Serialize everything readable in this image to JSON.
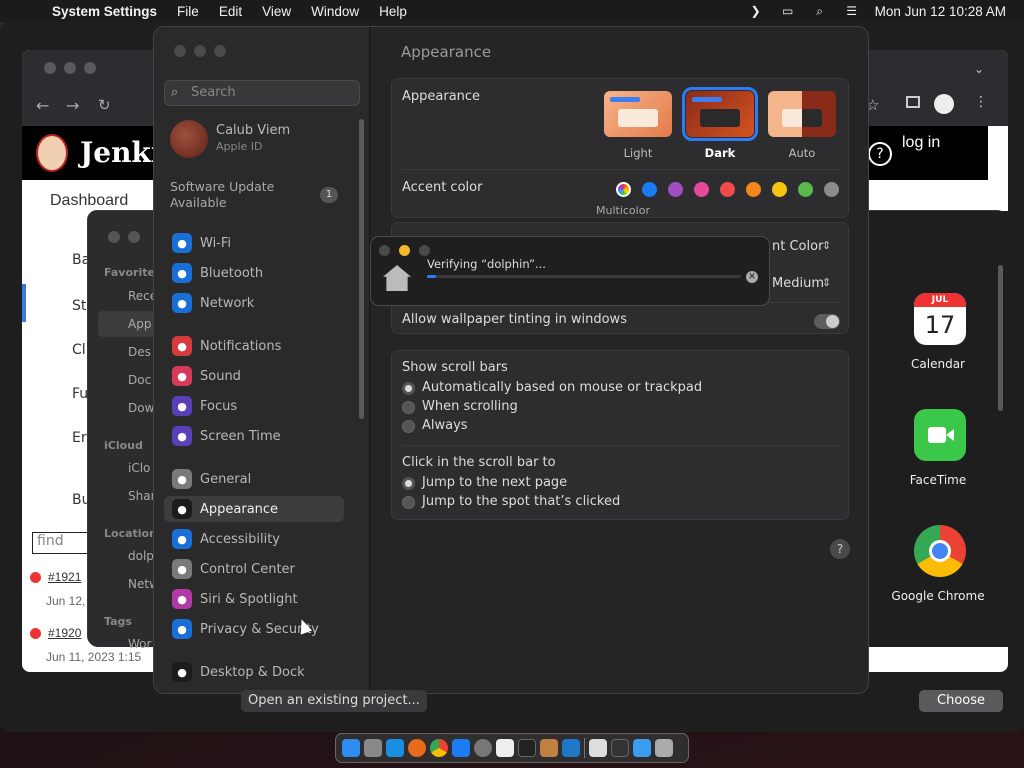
{
  "menubar": {
    "app": "System Settings",
    "items": [
      "File",
      "Edit",
      "View",
      "Window",
      "Help"
    ],
    "clock": "Mon Jun 12  10:28 AM"
  },
  "jenkins": {
    "title": "Jenki",
    "dashboard": "Dashboard",
    "login": "log in",
    "side_items": [
      "Ba",
      "St",
      "Cl",
      "Fu",
      "Er",
      "Bu"
    ],
    "find_placeholder": "find",
    "builds": [
      {
        "id": "#1921",
        "date": "Jun 12,"
      },
      {
        "id": "#1920",
        "date": "Jun 11, 2023 1:15"
      }
    ]
  },
  "finder": {
    "favorites_label": "Favorites",
    "favorites": [
      "Rece",
      "App",
      "Des",
      "Doc",
      "Dow"
    ],
    "icloud_label": "iCloud",
    "icloud": [
      "iClo",
      "Shar"
    ],
    "locations_label": "Location",
    "locations": [
      "dolp",
      "Netw"
    ],
    "tags_label": "Tags",
    "tags": [
      "Wor"
    ],
    "apps": [
      {
        "name": "Calendar",
        "month": "JUL",
        "day": "17"
      },
      {
        "name": "FaceTime"
      },
      {
        "name": "Google Chrome"
      }
    ]
  },
  "settings": {
    "search_placeholder": "Search",
    "user": {
      "name": "Calub Viem",
      "sub": "Apple ID"
    },
    "update": {
      "text": "Software Update Available",
      "count": "1"
    },
    "items": [
      {
        "label": "Wi-Fi",
        "color": "#1a6fd6",
        "icon": "wifi-icon"
      },
      {
        "label": "Bluetooth",
        "color": "#1a6fd6",
        "icon": "bluetooth-icon"
      },
      {
        "label": "Network",
        "color": "#1a6fd6",
        "icon": "globe-icon"
      },
      {
        "label": "Notifications",
        "color": "#d63a3a",
        "icon": "bell-icon"
      },
      {
        "label": "Sound",
        "color": "#d63a5a",
        "icon": "speaker-icon"
      },
      {
        "label": "Focus",
        "color": "#5b3fb8",
        "icon": "moon-icon"
      },
      {
        "label": "Screen Time",
        "color": "#5b3fb8",
        "icon": "hourglass-icon"
      },
      {
        "label": "General",
        "color": "#7a7a7c",
        "icon": "gear-icon"
      },
      {
        "label": "Appearance",
        "color": "#1c1c1e",
        "icon": "appearance-icon"
      },
      {
        "label": "Accessibility",
        "color": "#1a6fd6",
        "icon": "accessibility-icon"
      },
      {
        "label": "Control Center",
        "color": "#7a7a7c",
        "icon": "control-center-icon"
      },
      {
        "label": "Siri & Spotlight",
        "color": "#b03aa8",
        "icon": "siri-icon"
      },
      {
        "label": "Privacy & Security",
        "color": "#1a6fd6",
        "icon": "hand-icon"
      },
      {
        "label": "Desktop & Dock",
        "color": "#1c1c1e",
        "icon": "dock-icon"
      }
    ],
    "page_title": "Appearance",
    "appearance": {
      "label": "Appearance",
      "options": [
        "Light",
        "Dark",
        "Auto"
      ],
      "selected": "Dark"
    },
    "accent": {
      "label": "Accent color",
      "colors": [
        "#a86ad8",
        "#1a7cf0",
        "#a04fc0",
        "#e54a9a",
        "#ee4b4b",
        "#f2871b",
        "#f5c411",
        "#5bb84a",
        "#8c8c8c"
      ],
      "caption": "Multicolor"
    },
    "highlight_value": "nt Color",
    "sidebar_icon_size_value": "Medium",
    "wallpaper_tinting": "Allow wallpaper tinting in windows",
    "scroll": {
      "title": "Show scroll bars",
      "options": [
        "Automatically based on mouse or trackpad",
        "When scrolling",
        "Always"
      ],
      "click_title": "Click in the scroll bar to",
      "click_options": [
        "Jump to the next page",
        "Jump to the spot that’s clicked"
      ]
    }
  },
  "verify": {
    "text": "Verifying “dolphin”...",
    "progress": 0.03
  },
  "bottom": {
    "open": "Open an existing project...",
    "choose": "Choose"
  }
}
